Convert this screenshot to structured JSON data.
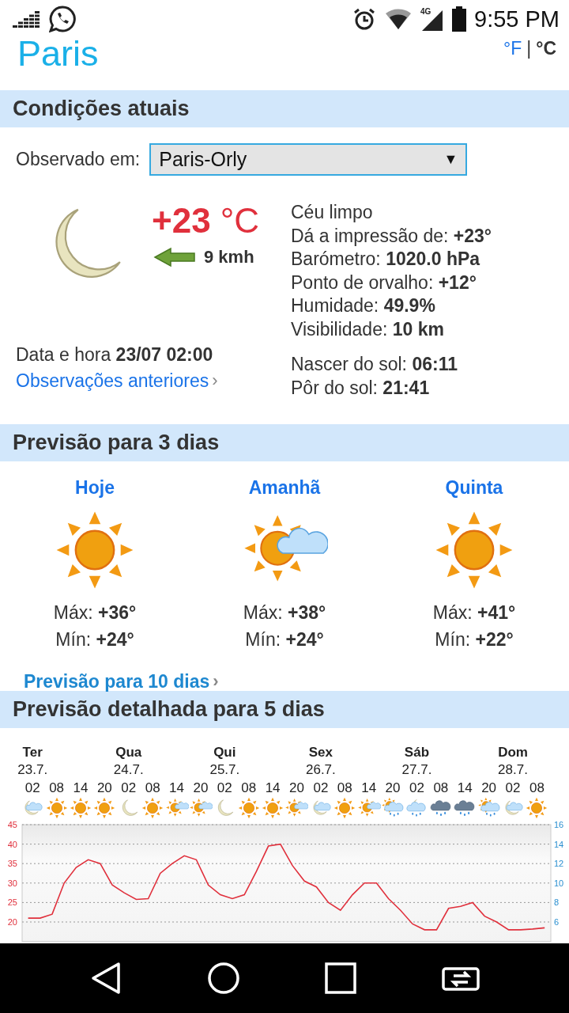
{
  "status_bar": {
    "time": "9:55 PM",
    "network": "4G"
  },
  "header": {
    "city": "Paris",
    "separator": "|",
    "units": [
      {
        "label": "°F",
        "selected": false
      },
      {
        "label": "°C",
        "selected": true
      }
    ]
  },
  "current": {
    "title": "Condições atuais",
    "observed_label": "Observado em:",
    "station": "Paris-Orly",
    "dropdown_arrow": "▼",
    "kind": "moon",
    "temperature": "+23",
    "unit": "°C",
    "wind": "9 kmh",
    "details": [
      {
        "label": "Céu limpo"
      },
      {
        "label": "Dá a impressão de:",
        "value": "+23°"
      },
      {
        "label": "Barómetro:",
        "value": "1020.0 hPa"
      },
      {
        "label": "Ponto de orvalho:",
        "value": "+12°"
      },
      {
        "label": "Humidade:",
        "value": "49.9%"
      },
      {
        "label": "Visibilidade:",
        "value": "10 km"
      }
    ],
    "datetime_label": "Data e hora",
    "datetime": "23/07 02:00",
    "history_link": "Observações anteriores",
    "chevron": "›",
    "sun": [
      {
        "label": "Nascer do sol:",
        "value": "06:11"
      },
      {
        "label": "Pôr do sol:",
        "value": "21:41"
      }
    ]
  },
  "forecast_3day": {
    "title": "Previsão para 3 dias",
    "link": "Previsão para 10 dias",
    "chevron": "›",
    "days": [
      {
        "name": "Hoje",
        "kind": "sun",
        "max_label": "Máx:",
        "max": "+36°",
        "min_label": "Mín:",
        "min": "+24°"
      },
      {
        "name": "Amanhã",
        "kind": "sun-cloud",
        "max_label": "Máx:",
        "max": "+38°",
        "min_label": "Mín:",
        "min": "+24°"
      },
      {
        "name": "Quinta",
        "kind": "sun",
        "max_label": "Máx:",
        "max": "+41°",
        "min_label": "Mín:",
        "min": "+22°"
      }
    ]
  },
  "forecast_5day": {
    "title": "Previsão detalhada para 5 dias",
    "days": [
      {
        "name": "Ter",
        "date": "23.7."
      },
      {
        "name": "Qua",
        "date": "24.7."
      },
      {
        "name": "Qui",
        "date": "25.7."
      },
      {
        "name": "Sex",
        "date": "26.7."
      },
      {
        "name": "Sáb",
        "date": "27.7."
      },
      {
        "name": "Dom",
        "date": "28.7."
      }
    ],
    "slots": [
      {
        "time": "02",
        "kind": "moon-cloud"
      },
      {
        "time": "08",
        "kind": "sun"
      },
      {
        "time": "14",
        "kind": "sun"
      },
      {
        "time": "20",
        "kind": "sun"
      },
      {
        "time": "02",
        "kind": "moon"
      },
      {
        "time": "08",
        "kind": "sun"
      },
      {
        "time": "14",
        "kind": "sun-cloud"
      },
      {
        "time": "20",
        "kind": "sun-cloud"
      },
      {
        "time": "02",
        "kind": "moon"
      },
      {
        "time": "08",
        "kind": "sun"
      },
      {
        "time": "14",
        "kind": "sun"
      },
      {
        "time": "20",
        "kind": "sun-cloud"
      },
      {
        "time": "02",
        "kind": "moon-cloud"
      },
      {
        "time": "08",
        "kind": "sun"
      },
      {
        "time": "14",
        "kind": "sun-cloud"
      },
      {
        "time": "20",
        "kind": "sun-rain"
      },
      {
        "time": "02",
        "kind": "moon-rain"
      },
      {
        "time": "08",
        "kind": "rain"
      },
      {
        "time": "14",
        "kind": "rain"
      },
      {
        "time": "20",
        "kind": "sun-rain"
      },
      {
        "time": "02",
        "kind": "moon-cloud"
      },
      {
        "time": "08",
        "kind": "sun"
      }
    ],
    "precip_ticks": [
      "16",
      "14",
      "12",
      "10",
      "8",
      "6"
    ],
    "chart_data": {
      "type": "line",
      "grid": true,
      "ylim": [
        15,
        45
      ],
      "yticks": [
        20,
        25,
        30,
        35,
        40,
        45
      ],
      "series": [
        {
          "color": "#e0303c",
          "values": [
            21,
            21,
            22,
            30,
            34,
            36,
            35,
            29.5,
            27.5,
            25.8,
            26,
            32.5,
            35,
            37,
            36,
            29.5,
            27,
            26,
            27,
            33,
            39.5,
            40,
            34.5,
            30.5,
            29,
            25,
            23,
            27,
            30,
            30,
            26,
            23,
            19.5,
            18,
            18,
            23.5,
            24,
            25,
            21.5,
            20,
            18,
            18,
            18.2,
            18.5
          ]
        }
      ]
    }
  }
}
